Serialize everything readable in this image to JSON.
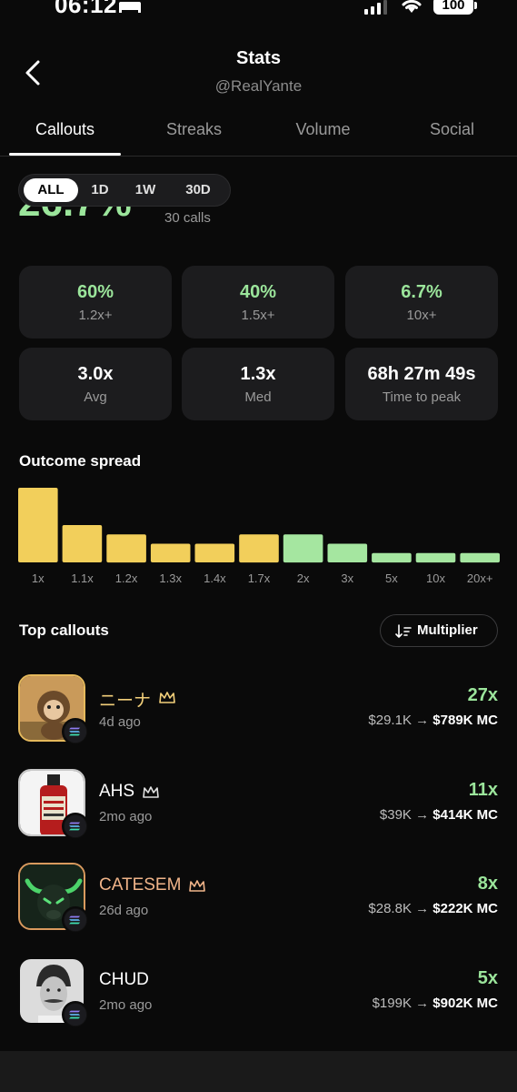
{
  "status_bar": {
    "time": "06:12",
    "battery": "100"
  },
  "header": {
    "title": "Stats",
    "handle": "@RealYante"
  },
  "tabs": [
    {
      "label": "Callouts",
      "active": true
    },
    {
      "label": "Streaks",
      "active": false
    },
    {
      "label": "Volume",
      "active": false
    },
    {
      "label": "Social",
      "active": false
    }
  ],
  "period_filter": {
    "options": [
      "ALL",
      "1D",
      "1W",
      "30D"
    ],
    "selected": "ALL"
  },
  "headline": {
    "value": "26.7%",
    "subtitle": "30 calls"
  },
  "stat_cards": [
    {
      "value": "60%",
      "label": "1.2x+",
      "color": "green"
    },
    {
      "value": "40%",
      "label": "1.5x+",
      "color": "green"
    },
    {
      "value": "6.7%",
      "label": "10x+",
      "color": "green"
    },
    {
      "value": "3.0x",
      "label": "Avg",
      "color": "white"
    },
    {
      "value": "1.3x",
      "label": "Med",
      "color": "white"
    },
    {
      "value": "68h 27m 49s",
      "label": "Time to peak",
      "color": "white"
    }
  ],
  "outcome_spread": {
    "title": "Outcome spread"
  },
  "chart_data": {
    "type": "bar",
    "categories": [
      "1x",
      "1.1x",
      "1.2x",
      "1.3x",
      "1.4x",
      "1.7x",
      "2x",
      "3x",
      "5x",
      "10x",
      "20x+"
    ],
    "values": [
      8,
      4,
      3,
      2,
      2,
      3,
      3,
      2,
      1,
      1,
      1
    ],
    "colors": [
      "#f2cf5b",
      "#f2cf5b",
      "#f2cf5b",
      "#f2cf5b",
      "#f2cf5b",
      "#f2cf5b",
      "#a5e6a0",
      "#a5e6a0",
      "#a5e6a0",
      "#a5e6a0",
      "#a5e6a0"
    ],
    "title": "Outcome spread",
    "xlabel": "",
    "ylabel": "",
    "grid": false
  },
  "top_callouts": {
    "title": "Top callouts",
    "sort_label": "Multiplier",
    "items": [
      {
        "name": "ニーナ",
        "age": "4d ago",
        "multiplier": "27x",
        "mc_from": "$29.1K",
        "mc_to": "$789K MC",
        "tier": "gold",
        "avatar_icon": "monkey-avatar"
      },
      {
        "name": "AHS",
        "age": "2mo ago",
        "multiplier": "11x",
        "mc_from": "$39K",
        "mc_to": "$414K MC",
        "tier": "silver",
        "avatar_icon": "hot-sauce-avatar"
      },
      {
        "name": "CATESEM",
        "age": "26d ago",
        "multiplier": "8x",
        "mc_from": "$28.8K",
        "mc_to": "$222K MC",
        "tier": "bronze",
        "avatar_icon": "bull-avatar"
      },
      {
        "name": "CHUD",
        "age": "2mo ago",
        "multiplier": "5x",
        "mc_from": "$199K",
        "mc_to": "$902K MC",
        "tier": "plain",
        "avatar_icon": "man-portrait-avatar"
      }
    ]
  },
  "colors": {
    "background": "#0a0a0a",
    "card": "#1c1c1e",
    "green": "#9be59b",
    "gold": "#f2cf5b"
  },
  "arrow_glyph": "→"
}
